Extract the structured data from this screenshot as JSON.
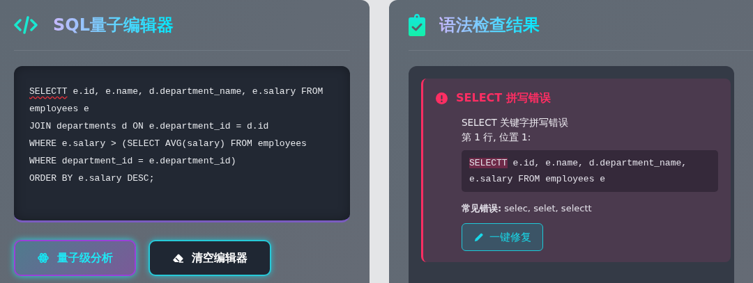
{
  "editor_panel": {
    "title": "SQL量子编辑器",
    "code_lines": [
      [
        {
          "text": "SELECTT",
          "misspelled": true
        },
        {
          "text": " e.id,  e.name,  d.department_name,  e.salary FROM",
          "misspelled": false
        }
      ],
      [
        {
          "text": "employees e",
          "misspelled": false
        }
      ],
      [
        {
          "text": "JOIN departments d ON e.department_id = d.id",
          "misspelled": false
        }
      ],
      [
        {
          "text": "WHERE e.salary > (SELECT AVG(salary) FROM employees",
          "misspelled": false
        }
      ],
      [
        {
          "text": "WHERE department_id = e.department_id)",
          "misspelled": false
        }
      ],
      [
        {
          "text": "ORDER BY e.salary DESC;",
          "misspelled": false
        }
      ]
    ],
    "buttons": [
      {
        "kind": "primary",
        "label": "量子级分析"
      },
      {
        "kind": "secondary",
        "label": "清空编辑器"
      }
    ]
  },
  "results_panel": {
    "title": "语法检查结果",
    "errors": [
      {
        "title": "SELECT 拼写错误",
        "description": "SELECT 关键字拼写错误",
        "location": "第 1 行, 位置 1:",
        "snippet_lines": [
          [
            {
              "text": "SELECTT",
              "highlighted": true
            },
            {
              "text": " e.id,  e.name,  d.department_name,",
              "highlighted": false
            }
          ],
          [
            {
              "text": "e.salary FROM employees e",
              "highlighted": false
            }
          ]
        ],
        "common_mistakes": "**常见错误:** selec, selet, selectt",
        "fix_button": "一键修复"
      }
    ]
  }
}
